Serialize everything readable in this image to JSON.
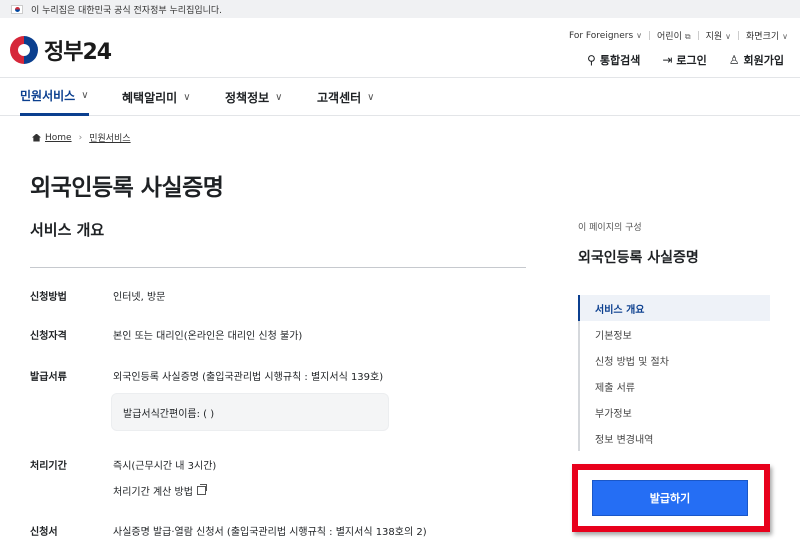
{
  "gov_banner": {
    "text": "이 누리집은 대한민국 공식 전자정부 누리집입니다."
  },
  "header": {
    "logo_text": "정부24",
    "utility_links": [
      {
        "label": "For Foreigners",
        "icon": "chevron-down-icon"
      },
      {
        "label": "어린이",
        "icon": "external-link-icon"
      },
      {
        "label": "지원",
        "icon": "chevron-down-icon"
      },
      {
        "label": "화면크기",
        "icon": "chevron-down-icon"
      }
    ],
    "actions": [
      {
        "label": "통합검색",
        "icon": "search-icon"
      },
      {
        "label": "로그인",
        "icon": "login-icon"
      },
      {
        "label": "회원가입",
        "icon": "user-add-icon"
      }
    ]
  },
  "gnb": {
    "items": [
      {
        "label": "민원서비스",
        "active": true
      },
      {
        "label": "혜택알리미",
        "active": false
      },
      {
        "label": "정책정보",
        "active": false
      },
      {
        "label": "고객센터",
        "active": false
      }
    ]
  },
  "breadcrumb": {
    "home": "Home",
    "current": "민원서비스"
  },
  "page": {
    "title": "외국인등록 사실증명",
    "section_title": "서비스 개요",
    "rows": [
      {
        "label": "신청방법",
        "value": "인터넷, 방문"
      },
      {
        "label": "신청자격",
        "value": "본인 또는 대리인(온라인은 대리인 신청 불가)"
      },
      {
        "label": "발급서류",
        "value": "외국인등록 사실증명 (출입국관리법 시행규칙 : 별지서식 139호)"
      },
      {
        "label": "처리기간",
        "value": "즉시(근무시간 내 3시간)"
      },
      {
        "label": "신청서",
        "value": "사실증명 발급·열람 신청서 (출입국관리법 시행규칙 : 별지서식 138호의 2)"
      }
    ],
    "issue_form_note": "발급서식간편이름: ( )",
    "processing_calc_link": "처리기간 계산 방법"
  },
  "toc": {
    "caption": "이 페이지의 구성",
    "title": "외국인등록 사실증명",
    "items": [
      {
        "label": "서비스 개요",
        "active": true
      },
      {
        "label": "기본정보",
        "active": false
      },
      {
        "label": "신청 방법 및 절차",
        "active": false
      },
      {
        "label": "제출 서류",
        "active": false
      },
      {
        "label": "부가정보",
        "active": false
      },
      {
        "label": "정보 변경내역",
        "active": false
      }
    ]
  },
  "apply": {
    "label": "발급하기"
  },
  "colors": {
    "primary": "#256ef4",
    "brand_navy": "#0b3f8f",
    "highlight": "#e8001c"
  }
}
